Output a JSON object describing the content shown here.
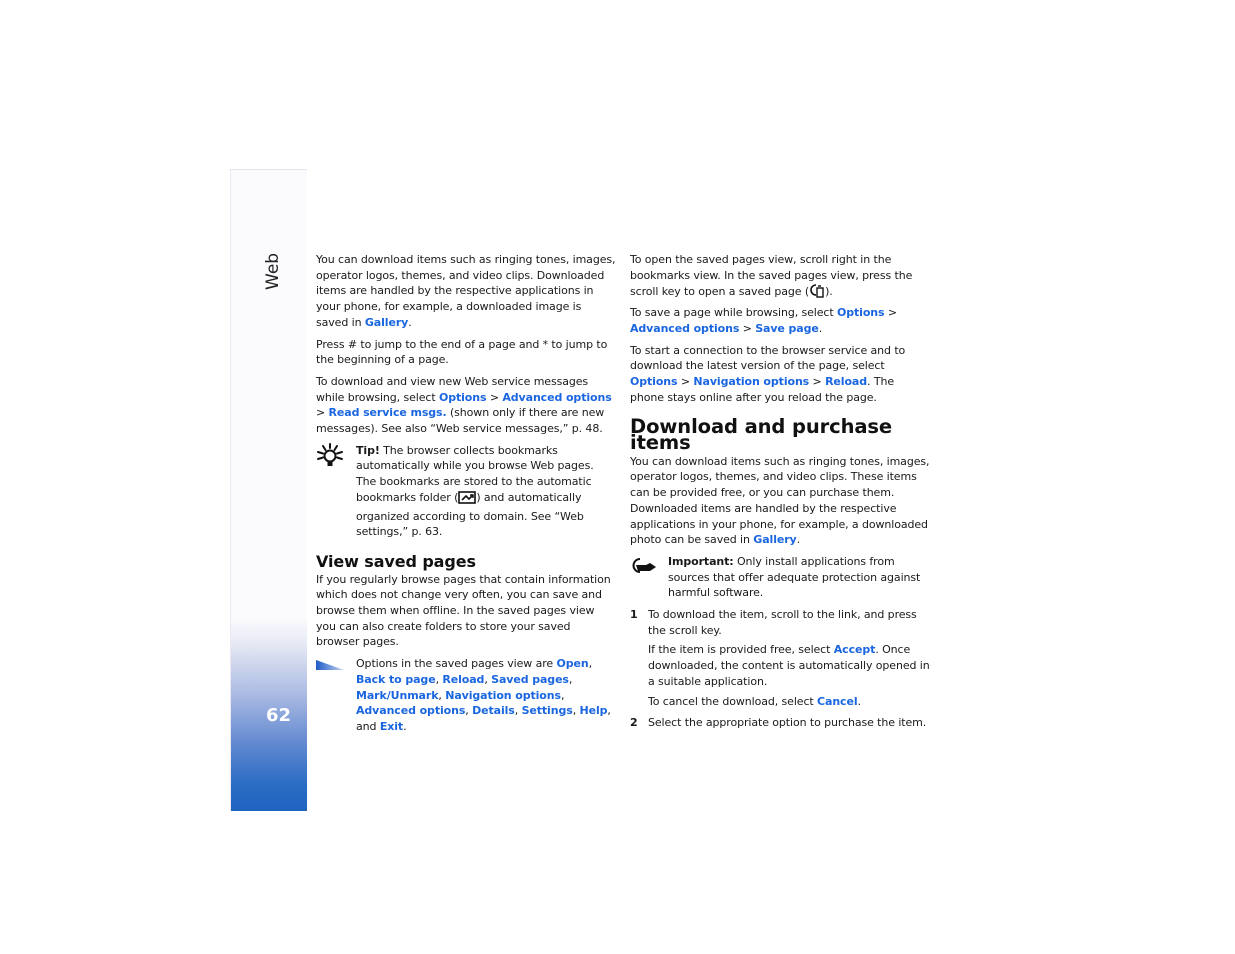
{
  "sidebar": {
    "section_label": "Web",
    "page_number": "62",
    "colors": {
      "gradient_top": "#fbfbfd",
      "gradient_bottom": "#1e64c0"
    }
  },
  "link_color": "#1a66e0",
  "left_column": {
    "para1": {
      "text": "You can download items such as ringing tones, images, operator logos, themes, and video clips. Downloaded items are handled by the respective applications in your phone, for example, a downloaded image is saved in ",
      "link": "Gallery",
      "end": "."
    },
    "para2": "Press # to jump to the end of a page and * to jump to the beginning of a page.",
    "para3": {
      "text": "To download and view new Web service messages while browsing, select ",
      "link1": "Options",
      "sep1": " > ",
      "link2": "Advanced options",
      "sep2": " > ",
      "link3": "Read service msgs.",
      "end": " (shown only if there are new messages). See also “Web service messages,” p. 48."
    },
    "tip": {
      "icon": "lightbulb-icon",
      "label": "Tip!",
      "text1": " The browser collects bookmarks automatically while you browse Web pages. The bookmarks are stored to the automatic bookmarks folder (",
      "folder_icon": "auto-bookmarks-folder-icon",
      "text2": ") and automatically organized according to domain. See “Web settings,” p. 63."
    },
    "view_saved_pages": {
      "heading": "View saved pages",
      "para": "If you regularly browse pages that contain information which does not change very often, you can save and browse them when offline. In the saved pages view you can also create folders to store your saved browser pages.",
      "options_note": {
        "icon": "options-triangle-icon",
        "intro": "Options in the saved pages view are ",
        "items": [
          "Open",
          "Back to page",
          "Reload",
          "Saved pages",
          "Mark/Unmark",
          "Navigation options",
          "Advanced options",
          "Details",
          "Settings",
          "Help"
        ],
        "and": "and",
        "last": "Exit",
        "end": "."
      }
    }
  },
  "right_column": {
    "para1": {
      "text": "To open the saved pages view, scroll right in the bookmarks view. In the saved pages view, press the scroll key to open a saved page (",
      "icon": "saved-page-icon",
      "end": ")."
    },
    "para2": {
      "text": "To save a page while browsing, select ",
      "link1": "Options",
      "sep1": " > ",
      "link2": "Advanced options",
      "sep2": " > ",
      "link3": "Save page",
      "end": "."
    },
    "para3": {
      "text": "To start a connection to the browser service and to download the latest version of the page, select ",
      "link1": "Options",
      "sep1": " > ",
      "link2": "Navigation options",
      "sep2": " > ",
      "link3": "Reload",
      "end": ". The phone stays online after you reload the page."
    },
    "download_section": {
      "heading": "Download and purchase items",
      "para": {
        "text": "You can download items such as ringing tones, images, operator logos, themes, and video clips. These items can be provided free, or you can purchase them. Downloaded items are handled by the respective applications in your phone, for example, a downloaded photo can be saved in ",
        "link": "Gallery",
        "end": "."
      },
      "important": {
        "icon": "important-hand-icon",
        "label": "Important:",
        "text": " Only install applications from sources that offer adequate protection against harmful software."
      },
      "steps": [
        {
          "number": "1",
          "text": "To download the item, scroll to the link, and press the scroll key.",
          "sub1": {
            "text": "If the item is provided free, select ",
            "link": "Accept",
            "end": ". Once downloaded, the content is automatically opened in a suitable application."
          },
          "sub2": {
            "text": "To cancel the download, select ",
            "link": "Cancel",
            "end": "."
          }
        },
        {
          "number": "2",
          "text": "Select the appropriate option to purchase the item."
        }
      ]
    }
  }
}
